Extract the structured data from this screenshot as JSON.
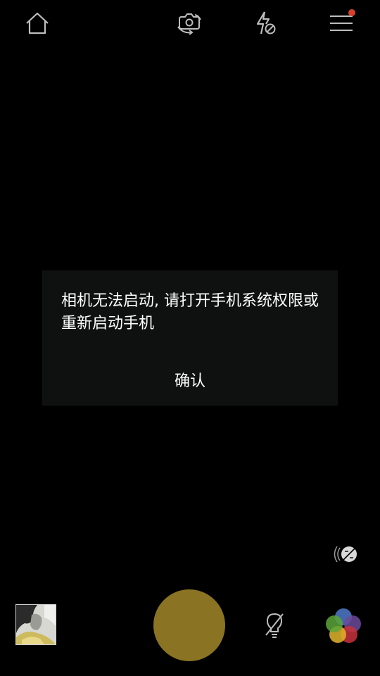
{
  "icons": {
    "home": "home-icon",
    "camera_switch": "camera-switch-icon",
    "flash": "flash-off-icon",
    "menu": "menu-icon",
    "exposure": "exposure-compensation-icon",
    "light": "light-off-icon",
    "filters": "filters-icon"
  },
  "colors": {
    "background": "#000000",
    "dialog_background": "#0f1111",
    "shutter": "#8a7322",
    "notification_dot": "#d6402c"
  },
  "dialog": {
    "message": "相机无法启动, 请打开手机系统权限或重新启动手机",
    "confirm_label": "确认"
  }
}
